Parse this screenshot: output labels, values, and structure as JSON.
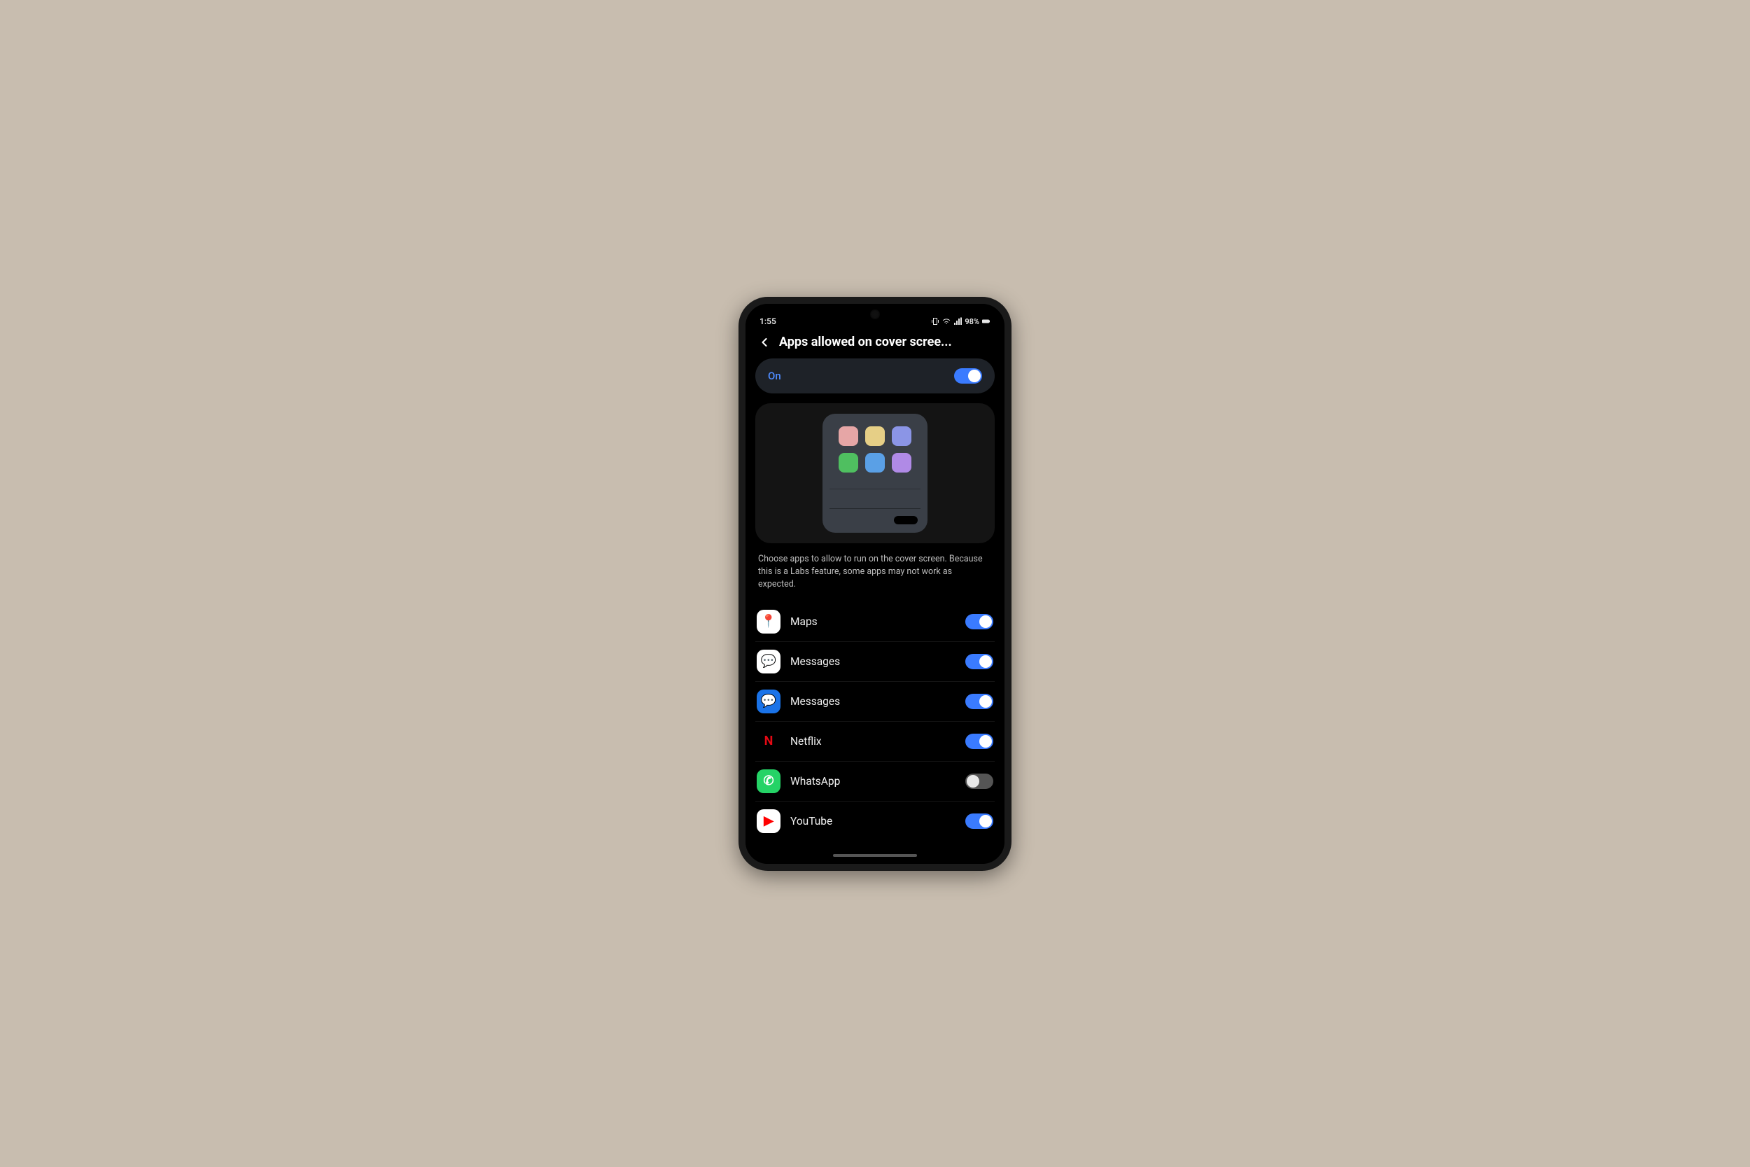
{
  "statusbar": {
    "time": "1:55",
    "battery_text": "98%"
  },
  "header": {
    "title": "Apps allowed on cover scree..."
  },
  "master_toggle": {
    "label": "On",
    "enabled": true
  },
  "description": "Choose apps to allow to run on the cover screen. Because this is a Labs feature, some apps may not work as expected.",
  "apps": [
    {
      "name": "Maps",
      "enabled": true,
      "icon_bg": "#ffffff",
      "icon_fg": "#34a853",
      "glyph": "📍"
    },
    {
      "name": "Messages",
      "enabled": true,
      "icon_bg": "#ffffff",
      "icon_fg": "#1a73e8",
      "glyph": "💬"
    },
    {
      "name": "Messages",
      "enabled": true,
      "icon_bg": "#1a73e8",
      "icon_fg": "#ffffff",
      "glyph": "💬"
    },
    {
      "name": "Netflix",
      "enabled": true,
      "icon_bg": "#000000",
      "icon_fg": "#e50914",
      "glyph": "N"
    },
    {
      "name": "WhatsApp",
      "enabled": false,
      "icon_bg": "#25d366",
      "icon_fg": "#ffffff",
      "glyph": "✆"
    },
    {
      "name": "YouTube",
      "enabled": true,
      "icon_bg": "#ffffff",
      "icon_fg": "#ff0000",
      "glyph": "▶"
    }
  ]
}
